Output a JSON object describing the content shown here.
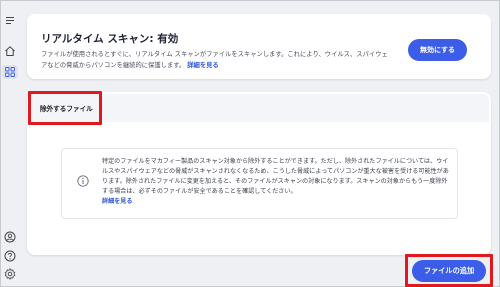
{
  "realtime": {
    "title": "リアルタイム スキャン: 有効",
    "description": "ファイルが使用されるとすぐに、リアルタイム スキャンがファイルをスキャンします。これにより、ウイルス、スパイウェアなどの脅威からパソコンを継続的に保護します。",
    "details_link": "詳細を見る",
    "disable_button": "無効にする"
  },
  "excluded": {
    "tab_label": "除外するファイル",
    "info_text": "特定のファイルをマカフィー製品のスキャン対象から除外することができます。ただし、除外されたファイルについては、ウイルスやスパイウェアなどの脅威がスキャンされなくなるため、こうした脅威によってパソコンが重大な被害を受ける可能性があります。除外されたファイルに変更を加えると、そのファイルがスキャンの対象になります。スキャンの対象からもう一度除外する場合は、必ずそのファイルが安全であることを確認してください。",
    "details_link": "詳細を見る"
  },
  "actions": {
    "add_file_button": "ファイルの追加"
  },
  "colors": {
    "accent": "#3b5de7",
    "highlight": "#e0191e",
    "link": "#2f55d4"
  },
  "icons": {
    "menu": "hamburger-menu-icon",
    "home": "home-icon",
    "apps": "grid-icon",
    "account": "account-icon",
    "help": "help-icon",
    "settings": "gear-icon",
    "info": "info-icon"
  }
}
